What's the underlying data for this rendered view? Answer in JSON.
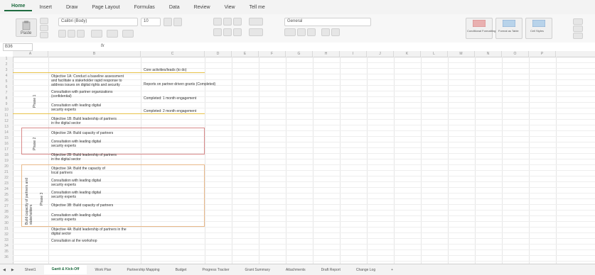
{
  "ribbon": {
    "tabs": [
      "Home",
      "Insert",
      "Draw",
      "Page Layout",
      "Formulas",
      "Data",
      "Review",
      "View",
      "Tell me"
    ],
    "paste_label": "Paste",
    "font_name": "Calibri (Body)",
    "font_size": "10",
    "number_format": "General",
    "styles": [
      "Conditional Formatting",
      "Format as Table",
      "Cell Styles"
    ]
  },
  "formula_bar": {
    "name_box": "B36",
    "fx": "fx"
  },
  "grid": {
    "columns": [
      "A",
      "B",
      "C",
      "D",
      "E",
      "F",
      "G",
      "H",
      "I",
      "J",
      "K",
      "L",
      "M",
      "N",
      "O",
      "P"
    ],
    "rows": [
      "1",
      "2",
      "3",
      "4",
      "5",
      "6",
      "7",
      "8",
      "9",
      "10",
      "11",
      "12",
      "13",
      "14",
      "15",
      "16",
      "17",
      "18",
      "19",
      "20",
      "21",
      "22",
      "23",
      "24",
      "25",
      "26",
      "27",
      "28",
      "29",
      "30",
      "31",
      "32",
      "33",
      "34",
      "35",
      "36"
    ],
    "blocks": [
      {
        "lines": [
          "Objective 1A: Conduct a baseline assessment",
          "and facilitate a stakeholder rapid response to",
          "address issues on digital rights and security"
        ]
      },
      {
        "lines": [
          "Consultation with partner organizations",
          "(confidential)"
        ]
      },
      {
        "lines": [
          "Consultation with leading digital",
          "security experts"
        ]
      },
      {
        "lines": [
          "Objective 1B: Build leadership of partners",
          "in the digital sector"
        ]
      },
      {
        "lines": [
          "Objective 2A: Build capacity of partners"
        ]
      },
      {
        "lines": [
          "Consultation with leading digital",
          "security experts"
        ]
      },
      {
        "lines": [
          "Objective 2B: Build leadership of partners",
          "in the digital sector"
        ]
      },
      {
        "lines": [
          "Objective 3A: Build the capacity of",
          "local partners"
        ]
      },
      {
        "lines": [
          "Consultation with leading digital",
          "security experts"
        ]
      },
      {
        "lines": [
          "Consultation with leading digital",
          "security experts"
        ]
      },
      {
        "lines": [
          "Objective 3B: Build capacity of partners"
        ]
      },
      {
        "lines": [
          "Consultation with leading digital",
          "security experts"
        ]
      },
      {
        "lines": [
          "Objective 4A: Build leadership of partners in the",
          "digital sector"
        ]
      },
      {
        "lines": [
          "Consultation at the workshop"
        ]
      }
    ],
    "notes": [
      "Core activities/leads (to do)",
      "Reports on partner-driven grants (Completed)",
      "Completed: 1 month engagement",
      "Completed: 2 month engagement"
    ],
    "vertical_labels": [
      "Phase 1",
      "Phase 2",
      "Build capacity of partners and stakeholders",
      "Phase 3"
    ]
  },
  "sheets": [
    "Sheet1",
    "Gantt & Kick-Off",
    "Work Plan",
    "Partnership Mapping",
    "Budget",
    "Progress Tracker",
    "Grant Summary",
    "Attachments",
    "Draft Report",
    "Change Log",
    "+"
  ],
  "active_sheet": 1,
  "colors": {
    "accent": "#1e6b3f",
    "sticky": "#f6d36b",
    "red_box": "#d98a8a",
    "orange_box": "#e9b98a",
    "yellow_line": "#e8c24a"
  }
}
